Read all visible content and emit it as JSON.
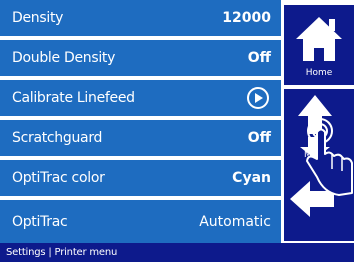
{
  "settings": [
    {
      "label": "Density",
      "value": "12000",
      "value_bold": true
    },
    {
      "label": "Double Density",
      "value": "Off",
      "value_bold": true
    },
    {
      "label": "Calibrate Linefeed",
      "value": "",
      "icon": "play-icon"
    },
    {
      "label": "Scratchguard",
      "value": "Off",
      "value_bold": true
    },
    {
      "label": "OptiTrac color",
      "value": "Cyan",
      "value_bold": true
    },
    {
      "label": "OptiTrac",
      "value": "Automatic",
      "value_bold": false
    }
  ],
  "nav": {
    "home_label": "Home",
    "move_label": "Move"
  },
  "statusbar": {
    "breadcrumb": "Settings | Printer menu"
  },
  "colors": {
    "row_blue": "#1e6cc0",
    "nav_dark": "#0d1a8c",
    "text": "#ffffff"
  }
}
